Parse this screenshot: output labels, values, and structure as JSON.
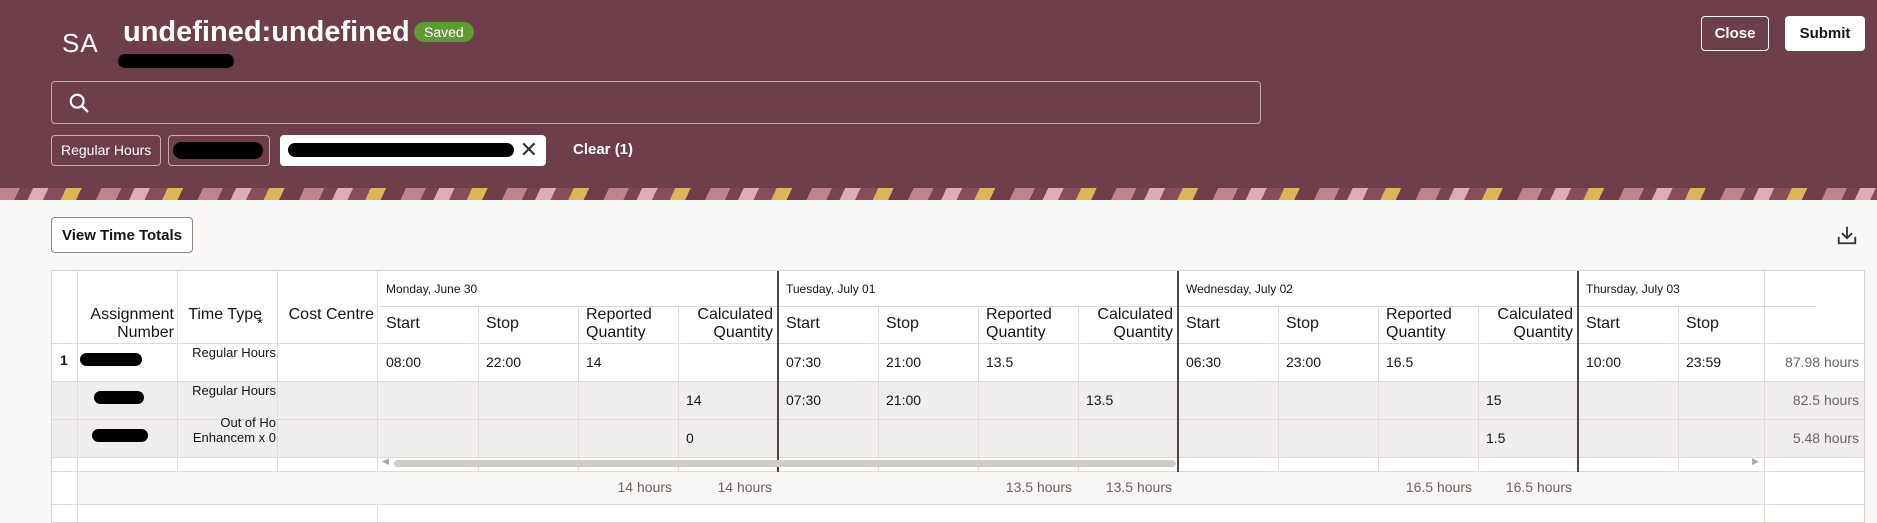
{
  "header": {
    "avatar": "SA",
    "title": "undefined:undefined",
    "status_badge": "Saved",
    "close_label": "Close",
    "submit_label": "Submit",
    "search_placeholder": "",
    "filters": {
      "regular_hours": "Regular Hours",
      "clear_label": "Clear (1)"
    }
  },
  "toolbar": {
    "view_totals_label": "View Time Totals"
  },
  "table": {
    "columns": {
      "assignment": "Assignment Number",
      "time_type": "Time Type",
      "required": "*",
      "cost_centre": "Cost Centre",
      "start": "Start",
      "stop": "Stop",
      "reported": "Reported Quantity",
      "calculated": "Calculated Quantity"
    },
    "days": [
      "Monday, June 30",
      "Tuesday, July 01",
      "Wednesday, July 02",
      "Thursday, July 03"
    ],
    "rows": [
      {
        "num": "1",
        "time_type": "Regular Hours",
        "mon": [
          "08:00",
          "22:00",
          "14",
          ""
        ],
        "tue": [
          "07:30",
          "21:00",
          "13.5",
          ""
        ],
        "wed": [
          "06:30",
          "23:00",
          "16.5",
          ""
        ],
        "thu": [
          "10:00",
          "23:59"
        ],
        "total": "87.98 hours"
      },
      {
        "num": "",
        "time_type": "Regular Hours",
        "mon": [
          "",
          "",
          "",
          "14"
        ],
        "tue": [
          "07:30",
          "21:00",
          "",
          "13.5"
        ],
        "wed": [
          "",
          "",
          "",
          "15"
        ],
        "thu": [
          "",
          ""
        ],
        "total": "82.5 hours"
      },
      {
        "num": "",
        "time_type": "Out of Ho Enhancem x 0",
        "mon": [
          "",
          "",
          "",
          "0"
        ],
        "tue": [
          "",
          "",
          "",
          ""
        ],
        "wed": [
          "",
          "",
          "",
          "1.5"
        ],
        "thu": [
          "",
          ""
        ],
        "total": "5.48 hours"
      }
    ],
    "totals": {
      "mon_reported": "14 hours",
      "mon_calculated": "14 hours",
      "tue_reported": "13.5 hours",
      "tue_calculated": "13.5 hours",
      "wed_reported": "16.5 hours",
      "wed_calculated": "16.5 hours"
    }
  },
  "icons": {
    "search": "search-icon",
    "download": "download-icon",
    "clear_chip": "close-icon"
  },
  "colors": {
    "header_bg": "#6e3f4a",
    "saved_badge": "#5f9a32"
  }
}
